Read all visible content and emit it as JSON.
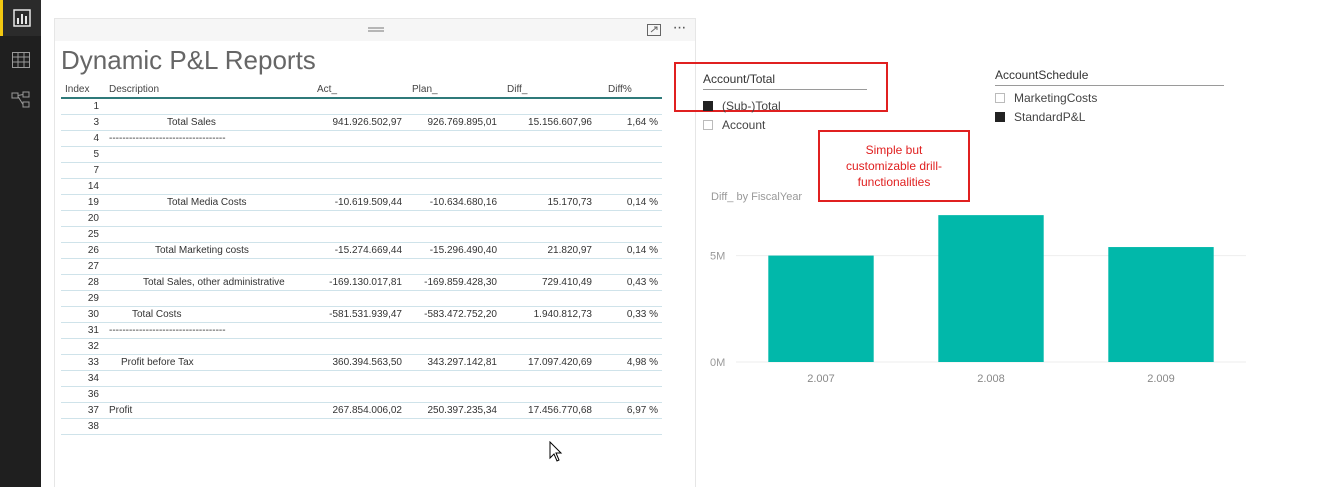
{
  "rail": {
    "items": [
      {
        "icon": "report-icon",
        "active": true
      },
      {
        "icon": "data-table-icon",
        "active": false
      },
      {
        "icon": "relationships-icon",
        "active": false
      }
    ]
  },
  "report": {
    "title": "Dynamic P&L Reports",
    "more_label": "···",
    "columns": [
      "Index",
      "Description",
      "Act_",
      "Plan_",
      "Diff_",
      "Diff%"
    ],
    "rows": [
      {
        "index": "1",
        "description": "",
        "act": "",
        "plan": "",
        "diff": "",
        "pct": "",
        "indent": 0
      },
      {
        "index": "3",
        "description": "Total Sales",
        "act": "941.926.502,97",
        "plan": "926.769.895,01",
        "diff": "15.156.607,96",
        "pct": "1,64 %",
        "indent": 58
      },
      {
        "index": "4",
        "description": "-----------------------------------",
        "act": "",
        "plan": "",
        "diff": "",
        "pct": "",
        "indent": 0
      },
      {
        "index": "5",
        "description": "",
        "act": "",
        "plan": "",
        "diff": "",
        "pct": "",
        "indent": 0
      },
      {
        "index": "7",
        "description": "",
        "act": "",
        "plan": "",
        "diff": "",
        "pct": "",
        "indent": 0
      },
      {
        "index": "14",
        "description": "",
        "act": "",
        "plan": "",
        "diff": "",
        "pct": "",
        "indent": 0
      },
      {
        "index": "19",
        "description": "Total Media Costs",
        "act": "-10.619.509,44",
        "plan": "-10.634.680,16",
        "diff": "15.170,73",
        "pct": "0,14 %",
        "indent": 58
      },
      {
        "index": "20",
        "description": "",
        "act": "",
        "plan": "",
        "diff": "",
        "pct": "",
        "indent": 0
      },
      {
        "index": "25",
        "description": "",
        "act": "",
        "plan": "",
        "diff": "",
        "pct": "",
        "indent": 0
      },
      {
        "index": "26",
        "description": "Total Marketing costs",
        "act": "-15.274.669,44",
        "plan": "-15.296.490,40",
        "diff": "21.820,97",
        "pct": "0,14 %",
        "indent": 46
      },
      {
        "index": "27",
        "description": "",
        "act": "",
        "plan": "",
        "diff": "",
        "pct": "",
        "indent": 0
      },
      {
        "index": "28",
        "description": "Total Sales, other administrative",
        "act": "-169.130.017,81",
        "plan": "-169.859.428,30",
        "diff": "729.410,49",
        "pct": "0,43 %",
        "indent": 34
      },
      {
        "index": "29",
        "description": "",
        "act": "",
        "plan": "",
        "diff": "",
        "pct": "",
        "indent": 0
      },
      {
        "index": "30",
        "description": "Total Costs",
        "act": "-581.531.939,47",
        "plan": "-583.472.752,20",
        "diff": "1.940.812,73",
        "pct": "0,33 %",
        "indent": 23
      },
      {
        "index": "31",
        "description": "-----------------------------------",
        "act": "",
        "plan": "",
        "diff": "",
        "pct": "",
        "indent": 0
      },
      {
        "index": "32",
        "description": "",
        "act": "",
        "plan": "",
        "diff": "",
        "pct": "",
        "indent": 0
      },
      {
        "index": "33",
        "description": "Profit before Tax",
        "act": "360.394.563,50",
        "plan": "343.297.142,81",
        "diff": "17.097.420,69",
        "pct": "4,98 %",
        "indent": 12
      },
      {
        "index": "34",
        "description": "",
        "act": "",
        "plan": "",
        "diff": "",
        "pct": "",
        "indent": 0
      },
      {
        "index": "36",
        "description": "",
        "act": "",
        "plan": "",
        "diff": "",
        "pct": "",
        "indent": 0
      },
      {
        "index": "37",
        "description": "Profit",
        "act": "267.854.006,02",
        "plan": "250.397.235,34",
        "diff": "17.456.770,68",
        "pct": "6,97 %",
        "indent": 0
      },
      {
        "index": "38",
        "description": "",
        "act": "",
        "plan": "",
        "diff": "",
        "pct": "",
        "indent": 0
      }
    ]
  },
  "slicer_account_total": {
    "title": "Account/Total",
    "items": [
      {
        "label": "(Sub-)Total",
        "checked": true
      },
      {
        "label": "Account",
        "checked": false
      }
    ]
  },
  "slicer_account_schedule": {
    "title": "AccountSchedule",
    "items": [
      {
        "label": "MarketingCosts",
        "checked": false
      },
      {
        "label": "StandardP&L",
        "checked": true
      }
    ]
  },
  "annotation": {
    "text": "Simple but customizable drill-functionalities",
    "color": "#e02020"
  },
  "colors": {
    "accent": "#01b8aa",
    "table_header_border": "#2f7a7a",
    "rail_background": "#1f1f1f",
    "rail_active": "#f2c811"
  },
  "chart_data": {
    "type": "bar",
    "title": "Diff_ by FiscalYear",
    "categories": [
      "2.007",
      "2.008",
      "2.009"
    ],
    "values": [
      5000000,
      6900000,
      5400000
    ],
    "y_ticks": [
      {
        "value": 0,
        "label": "0M"
      },
      {
        "value": 5000000,
        "label": "5M"
      }
    ],
    "ylim": [
      0,
      7000000
    ],
    "grid": true,
    "color": "#01b8aa"
  }
}
